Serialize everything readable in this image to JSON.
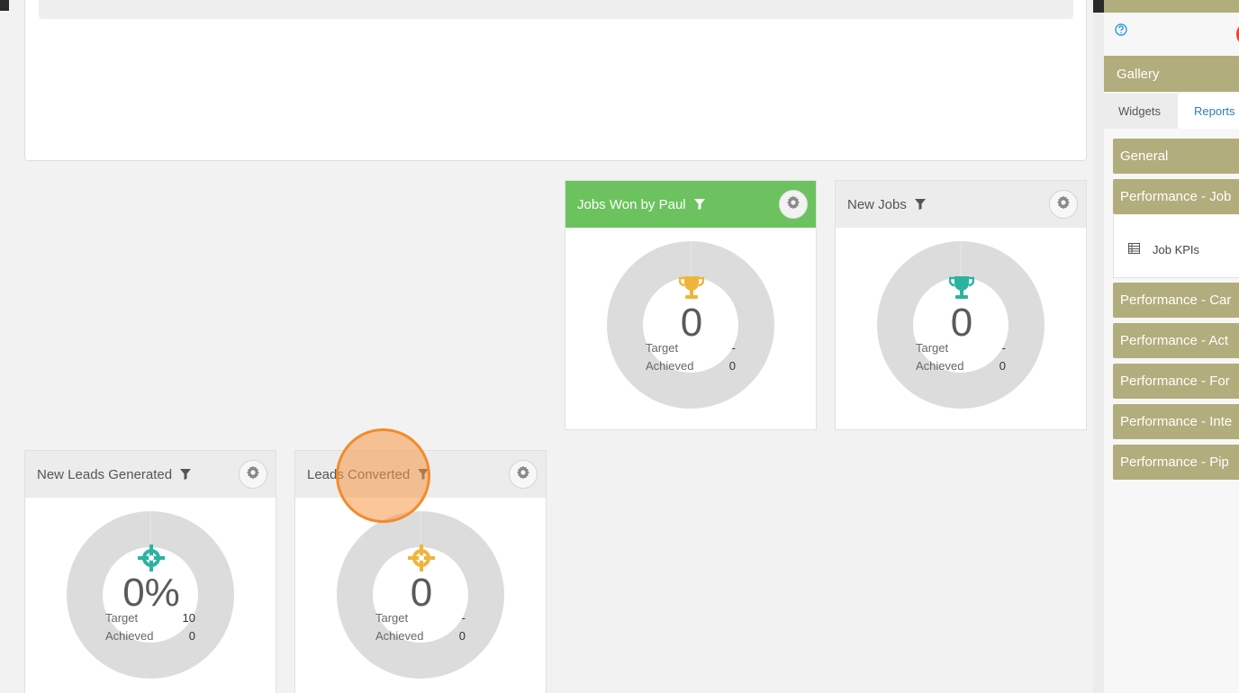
{
  "widgets": [
    {
      "title": "Jobs Won by Paul",
      "value": "0",
      "target_label": "Target",
      "target": "-",
      "achieved_label": "Achieved",
      "achieved": "0",
      "icon": "trophy-icon",
      "icon_color": "#f0b43c",
      "header_color": "#6cc25e"
    },
    {
      "title": "New Jobs",
      "value": "0",
      "target_label": "Target",
      "target": "-",
      "achieved_label": "Achieved",
      "achieved": "0",
      "icon": "trophy-icon",
      "icon_color": "#2bb3a0"
    },
    {
      "title": "New Leads Generated",
      "value": "0%",
      "target_label": "Target",
      "target": "10",
      "achieved_label": "Achieved",
      "achieved": "0",
      "icon": "crosshair-icon",
      "icon_color": "#2bb3a0"
    },
    {
      "title": "Leads Converted",
      "value": "0",
      "target_label": "Target",
      "target": "-",
      "achieved_label": "Achieved",
      "achieved": "0",
      "icon": "crosshair-icon",
      "icon_color": "#f0b43c"
    }
  ],
  "sidebar": {
    "gallery_title": "Gallery",
    "tabs": [
      {
        "label": "Widgets",
        "active": true
      },
      {
        "label": "Reports",
        "active": false
      }
    ],
    "sections": [
      {
        "label": "General"
      },
      {
        "label": "Performance - Job",
        "expanded": true,
        "items": [
          {
            "label": "Job KPIs",
            "icon": "table-icon"
          }
        ]
      },
      {
        "label": "Performance - Car"
      },
      {
        "label": "Performance - Act"
      },
      {
        "label": "Performance - For"
      },
      {
        "label": "Performance - Inte"
      },
      {
        "label": "Performance - Pip"
      }
    ]
  },
  "colors": {
    "sidebar_accent": "#b2ad7c",
    "link": "#2d7fb3",
    "donut_track": "#dcdcdc",
    "click_marker": "#f28b2d"
  }
}
